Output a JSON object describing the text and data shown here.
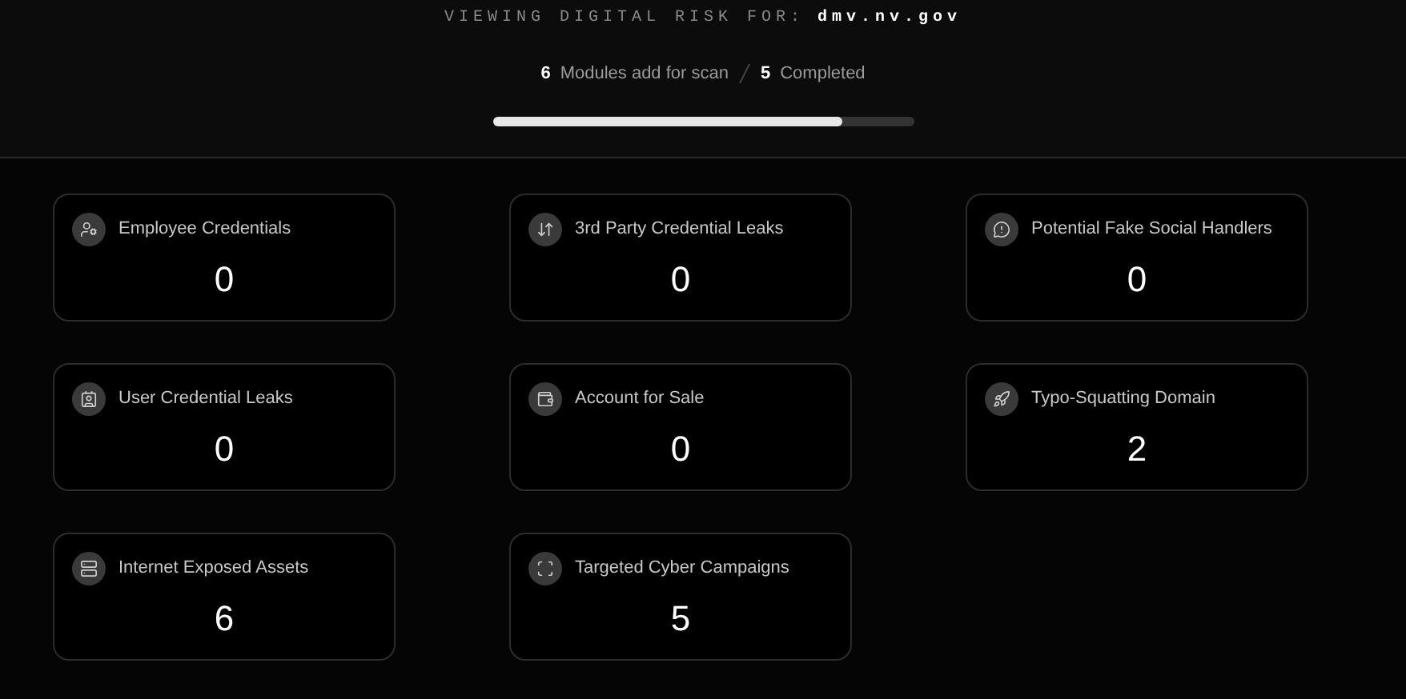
{
  "header": {
    "label": "VIEWING DIGITAL RISK FOR:",
    "domain": "dmv.nv.gov"
  },
  "scan": {
    "modules_count": "6",
    "modules_label": "Modules add for scan",
    "completed_count": "5",
    "completed_label": "Completed",
    "level": 0.83
  },
  "cards": [
    {
      "title": "Employee Credentials",
      "value": "0"
    },
    {
      "title": "3rd Party Credential Leaks",
      "value": "0"
    },
    {
      "title": "Potential Fake Social Handlers",
      "value": "0"
    },
    {
      "title": "User Credential Leaks",
      "value": "0"
    },
    {
      "title": "Account for Sale",
      "value": "0"
    },
    {
      "title": "Typo-Squatting Domain",
      "value": "2"
    },
    {
      "title": "Internet Exposed Assets",
      "value": "6"
    },
    {
      "title": "Targeted Cyber Campaigns",
      "value": "5"
    }
  ]
}
